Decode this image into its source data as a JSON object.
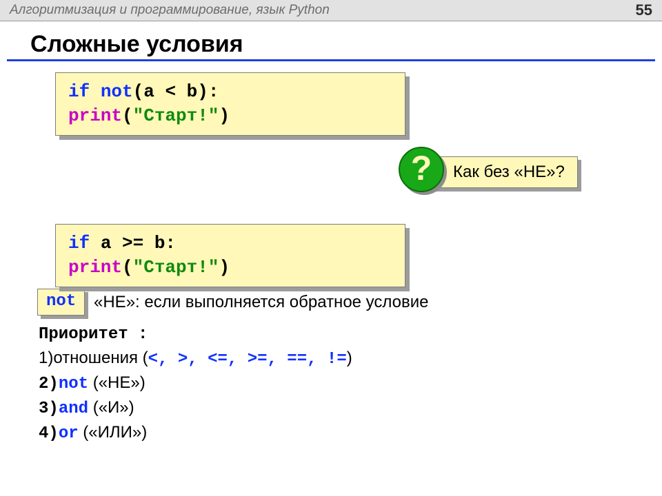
{
  "header": {
    "left": "Алгоритмизация и программирование, язык Python",
    "page": "55"
  },
  "title": "Сложные условия",
  "code1": {
    "l1_if": "if",
    "l1_not": " not",
    "l1_rest": "(a < b):",
    "l2_indent": "   ",
    "l2_print": "print",
    "l2_open": "(",
    "l2_str": "\"Старт!\"",
    "l2_close": ")"
  },
  "question": {
    "badge": "?",
    "text": "Как без «НЕ»?"
  },
  "not_box": "not",
  "not_text": "«НЕ»: если выполняется обратное условие",
  "code2": {
    "l1_if": "if",
    "l1_rest": " a >= b:",
    "l2_indent": "   ",
    "l2_print": "print",
    "l2_open": "(",
    "l2_str": "\"Старт!\"",
    "l2_close": ")"
  },
  "priority": {
    "heading": "Приоритет :",
    "p1_a": "1)отношения (",
    "p1_ops": "<, >, <=, >=, ==, !=",
    "p1_b": ")",
    "p2_a": "2)",
    "p2_kw": "not",
    "p2_b": " («НЕ»)",
    "p3_a": "3)",
    "p3_kw": "and",
    "p3_b": " («И»)",
    "p4_a": "4)",
    "p4_kw": "or",
    "p4_b": " («ИЛИ»)"
  }
}
